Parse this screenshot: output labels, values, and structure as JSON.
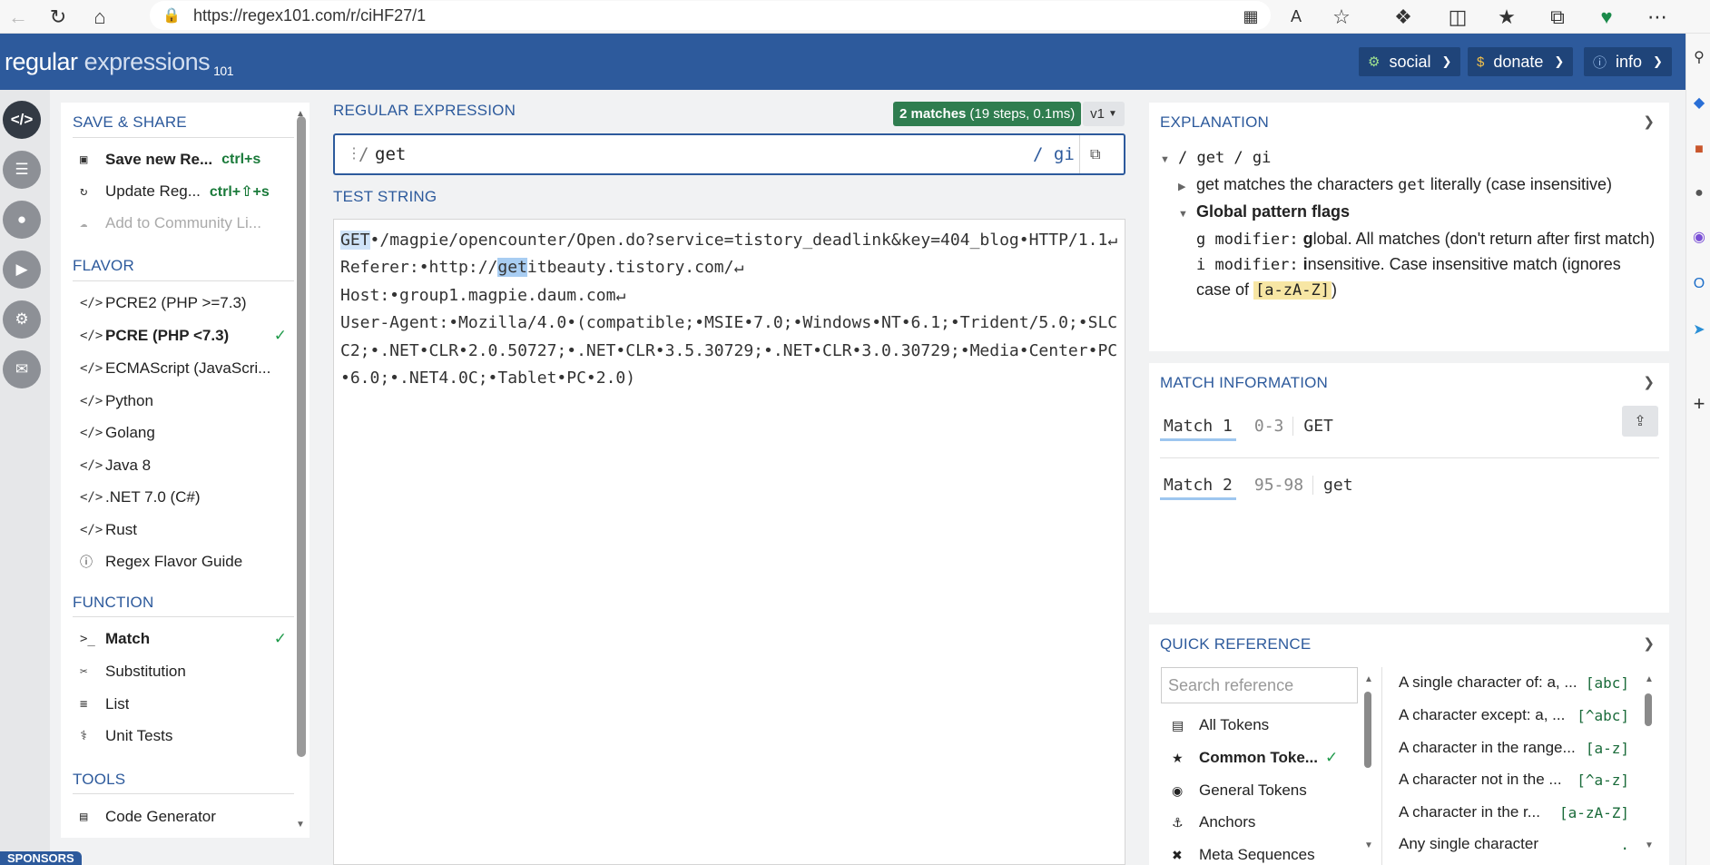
{
  "browser": {
    "url": "https://regex101.com/r/ciHF27/1",
    "lock_icon": "lock-icon"
  },
  "header": {
    "logo_main": "regular",
    "logo_light": "expressions",
    "logo_sub": "101",
    "social": "social",
    "donate": "donate",
    "info": "info"
  },
  "sidebar": {
    "save_share_title": "SAVE & SHARE",
    "save_new": "Save new Re...",
    "save_new_kbd": "ctrl+s",
    "update": "Update Reg...",
    "update_kbd": "ctrl+⇧+s",
    "community": "Add to Community Li...",
    "flavor_title": "FLAVOR",
    "flavors": [
      "PCRE2 (PHP >=7.3)",
      "PCRE (PHP <7.3)",
      "ECMAScript (JavaScri...",
      "Python",
      "Golang",
      "Java 8",
      ".NET 7.0 (C#)",
      "Rust",
      "Regex Flavor Guide"
    ],
    "function_title": "FUNCTION",
    "functions": [
      "Match",
      "Substitution",
      "List",
      "Unit Tests"
    ],
    "tools_title": "TOOLS",
    "tools": [
      "Code Generator"
    ]
  },
  "editor": {
    "regex_title": "REGULAR EXPRESSION",
    "matches_badge": "2 matches",
    "matches_detail": "(19 steps, 0.1ms)",
    "version": "v1",
    "delimiter": "/",
    "pattern": "get",
    "flags": "/ gi",
    "test_title": "TEST STRING",
    "test_parts": {
      "m1": "GET",
      "p1": "•/magpie/opencounter/Open.do?service=tistory_deadlink&key=404_blog•HTTP/1.1↵\nReferer:•http://",
      "m2": "get",
      "p2": "itbeauty.tistory.com/↵\nHost:•group1.magpie.daum.com↵\nUser-Agent:•Mozilla/4.0•(compatible;•MSIE•7.0;•Windows•NT•6.1;•Trident/5.0;•SLCC2;•.NET•CLR•2.0.50727;•.NET•CLR•3.5.30729;•.NET•CLR•3.0.30729;•Media•Center•PC•6.0;•.NET4.0C;•Tablet•PC•2.0)"
    }
  },
  "explanation": {
    "title": "EXPLANATION",
    "root": "/ get / gi",
    "token": "get",
    "token_desc_1": "matches the characters",
    "token_literal": "get",
    "token_desc_2": "literally (case insensitive)",
    "flags_title": "Global pattern flags",
    "g_label": "g modifier:",
    "g_bold": "g",
    "g_desc": "lobal. All matches (don't return after first match)",
    "i_label": "i modifier:",
    "i_bold": "i",
    "i_desc": "nsensitive. Case insensitive match (ignores case of",
    "i_token": "[a-zA-Z]",
    "i_close": ")"
  },
  "match_info": {
    "title": "MATCH INFORMATION",
    "matches": [
      {
        "label": "Match 1",
        "range": "0-3",
        "value": "GET"
      },
      {
        "label": "Match 2",
        "range": "95-98",
        "value": "get"
      }
    ]
  },
  "quick_ref": {
    "title": "QUICK REFERENCE",
    "search_placeholder": "Search reference",
    "categories": [
      "All Tokens",
      "Common Toke...",
      "General Tokens",
      "Anchors",
      "Meta Sequences"
    ],
    "items": [
      {
        "desc": "A single character of: a, ...",
        "token": "[abc]"
      },
      {
        "desc": "A character except: a, ...",
        "token": "[^abc]"
      },
      {
        "desc": "A character in the range...",
        "token": "[a-z]"
      },
      {
        "desc": "A character not in the ...",
        "token": "[^a-z]"
      },
      {
        "desc": "A character in the r...",
        "token": "[a-zA-Z]"
      },
      {
        "desc": "Any single character",
        "token": "."
      }
    ]
  },
  "sponsors": "SPONSORS",
  "colors": {
    "brand": "#2d5a9c",
    "match_badge": "#2f7d4f",
    "check": "#1f9a4a"
  }
}
